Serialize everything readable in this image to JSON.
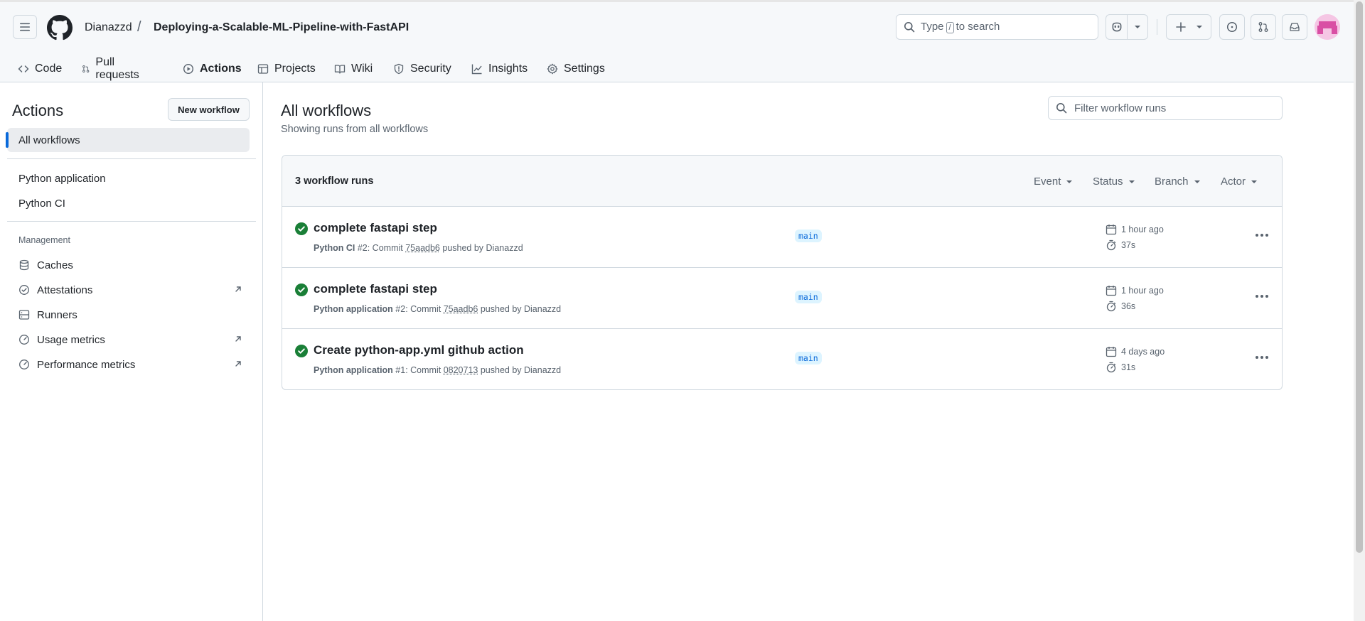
{
  "header": {
    "owner": "Dianazzd",
    "separator": "/",
    "repo": "Deploying-a-Scalable-ML-Pipeline-with-FastAPI",
    "search_prefix": "Type",
    "search_key": "/",
    "search_suffix": "to search"
  },
  "tabs": [
    {
      "label": "Code"
    },
    {
      "label": "Pull requests"
    },
    {
      "label": "Actions"
    },
    {
      "label": "Projects"
    },
    {
      "label": "Wiki"
    },
    {
      "label": "Security"
    },
    {
      "label": "Insights"
    },
    {
      "label": "Settings"
    }
  ],
  "sidebar": {
    "title": "Actions",
    "new_workflow": "New workflow",
    "all_workflows": "All workflows",
    "workflows": [
      "Python application",
      "Python CI"
    ],
    "management_heading": "Management",
    "management": [
      "Caches",
      "Attestations",
      "Runners",
      "Usage metrics",
      "Performance metrics"
    ]
  },
  "main": {
    "title": "All workflows",
    "subtitle": "Showing runs from all workflows",
    "filter_placeholder": "Filter workflow runs",
    "count": "3 workflow runs",
    "filters": [
      "Event",
      "Status",
      "Branch",
      "Actor"
    ]
  },
  "runs": [
    {
      "title": "complete fastapi step",
      "workflow": "Python CI",
      "number": "#2",
      "commit_label": ": Commit",
      "sha": "75aadb6",
      "pushed_by": "pushed by Dianazzd",
      "branch": "main",
      "when": "1 hour ago",
      "duration": "37s"
    },
    {
      "title": "complete fastapi step",
      "workflow": "Python application",
      "number": "#2",
      "commit_label": ": Commit",
      "sha": "75aadb6",
      "pushed_by": "pushed by Dianazzd",
      "branch": "main",
      "when": "1 hour ago",
      "duration": "36s"
    },
    {
      "title": "Create python-app.yml github action",
      "workflow": "Python application",
      "number": "#1",
      "commit_label": ": Commit",
      "sha": "0820713",
      "pushed_by": "pushed by Dianazzd",
      "branch": "main",
      "when": "4 days ago",
      "duration": "31s"
    }
  ],
  "colors": {
    "accent": "#0969da",
    "success": "#1a7f37",
    "tab_underline": "#fd8c73"
  }
}
